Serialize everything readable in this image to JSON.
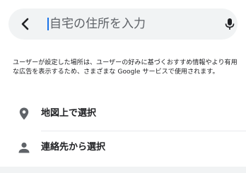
{
  "search": {
    "placeholder": "自宅の住所を入力",
    "value": ""
  },
  "icons": {
    "back": "back-arrow-icon",
    "mic": "microphone-icon",
    "map_option": "location-pin-icon",
    "contacts_option": "person-icon"
  },
  "notice": {
    "text": "ユーザーが設定した場所は、ユーザーの好みに基づくおすすめ情報やより有用な広告を表示するため、さまざまな Google サービスで使用されます。"
  },
  "options": [
    {
      "label": "地図上で選択"
    },
    {
      "label": "連絡先から選択"
    }
  ],
  "colors": {
    "search_background": "#f1f3f4",
    "caret": "#1a73e8",
    "icon": "#5f6368",
    "text": "#202124"
  }
}
